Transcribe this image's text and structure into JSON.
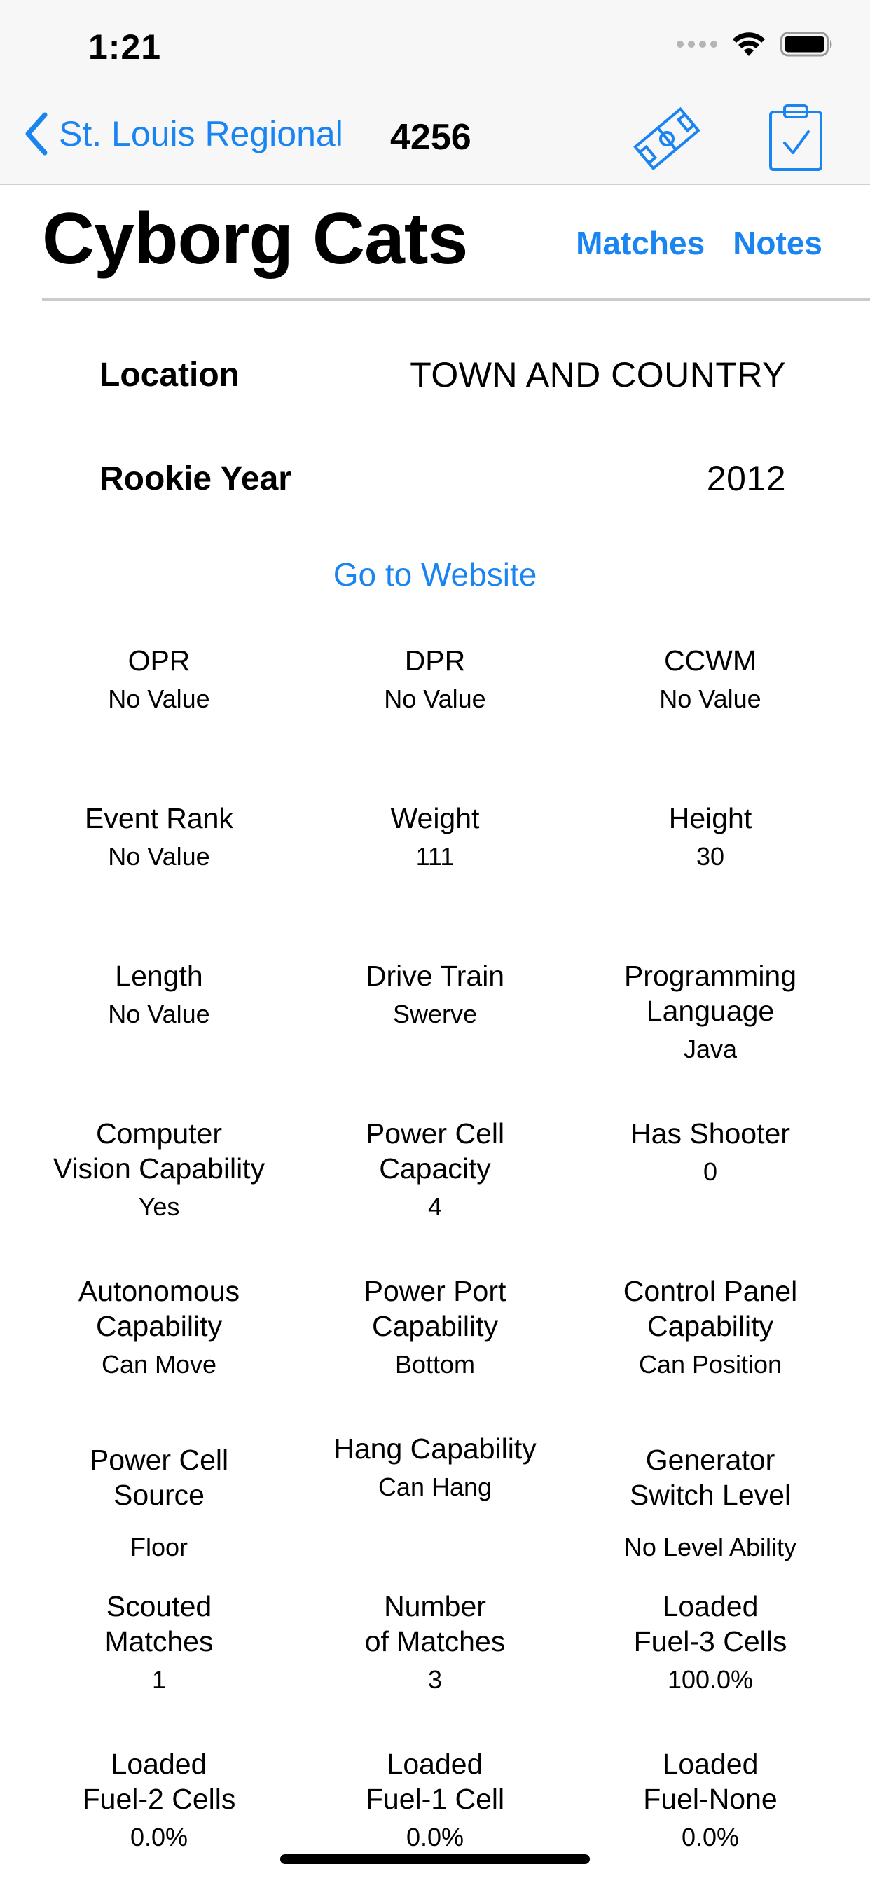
{
  "status_bar": {
    "time": "1:21"
  },
  "nav": {
    "back_label": "St. Louis Regional",
    "team_number": "4256"
  },
  "header": {
    "team_name": "Cyborg Cats",
    "links": {
      "matches": "Matches",
      "notes": "Notes"
    }
  },
  "info": {
    "location_label": "Location",
    "location_value": "TOWN AND COUNTRY",
    "rookie_label": "Rookie Year",
    "rookie_value": "2012",
    "website_label": "Go to Website"
  },
  "stats": [
    {
      "label": "OPR",
      "value": "No Value"
    },
    {
      "label": "DPR",
      "value": "No Value"
    },
    {
      "label": "CCWM",
      "value": "No Value"
    },
    {
      "label": "Event Rank",
      "value": "No Value"
    },
    {
      "label": "Weight",
      "value": "111"
    },
    {
      "label": "Height",
      "value": "30"
    },
    {
      "label": "Length",
      "value": "No Value"
    },
    {
      "label": "Drive Train",
      "value": "Swerve"
    },
    {
      "label": "Programming\nLanguage",
      "value": "Java"
    },
    {
      "label": "Computer\nVision Capability",
      "value": "Yes"
    },
    {
      "label": "Power Cell\nCapacity",
      "value": "4"
    },
    {
      "label": "Has Shooter",
      "value": "0"
    },
    {
      "label": "Autonomous\nCapability",
      "value": "Can Move"
    },
    {
      "label": "Power Port\nCapability",
      "value": "Bottom"
    },
    {
      "label": "Control Panel\nCapability",
      "value": "Can Position"
    },
    {
      "label": "Power Cell\nSource",
      "value": "Floor"
    },
    {
      "label": "Hang Capability",
      "value": "Can Hang"
    },
    {
      "label": "Generator\nSwitch Level",
      "value": "No Level Ability"
    },
    {
      "label": "Scouted\nMatches",
      "value": "1"
    },
    {
      "label": "Number\nof Matches",
      "value": "3"
    },
    {
      "label": "Loaded\nFuel-3 Cells",
      "value": "100.0%"
    },
    {
      "label": "Loaded\nFuel-2 Cells",
      "value": "0.0%"
    },
    {
      "label": "Loaded\nFuel-1 Cell",
      "value": "0.0%"
    },
    {
      "label": "Loaded\nFuel-None",
      "value": "0.0%"
    }
  ],
  "colors": {
    "accent": "#1a84f0"
  },
  "icons": {
    "back": "chevron-left-icon",
    "field": "field-icon",
    "clipboard": "clipboard-check-icon",
    "wifi": "wifi-icon",
    "battery": "battery-icon"
  }
}
